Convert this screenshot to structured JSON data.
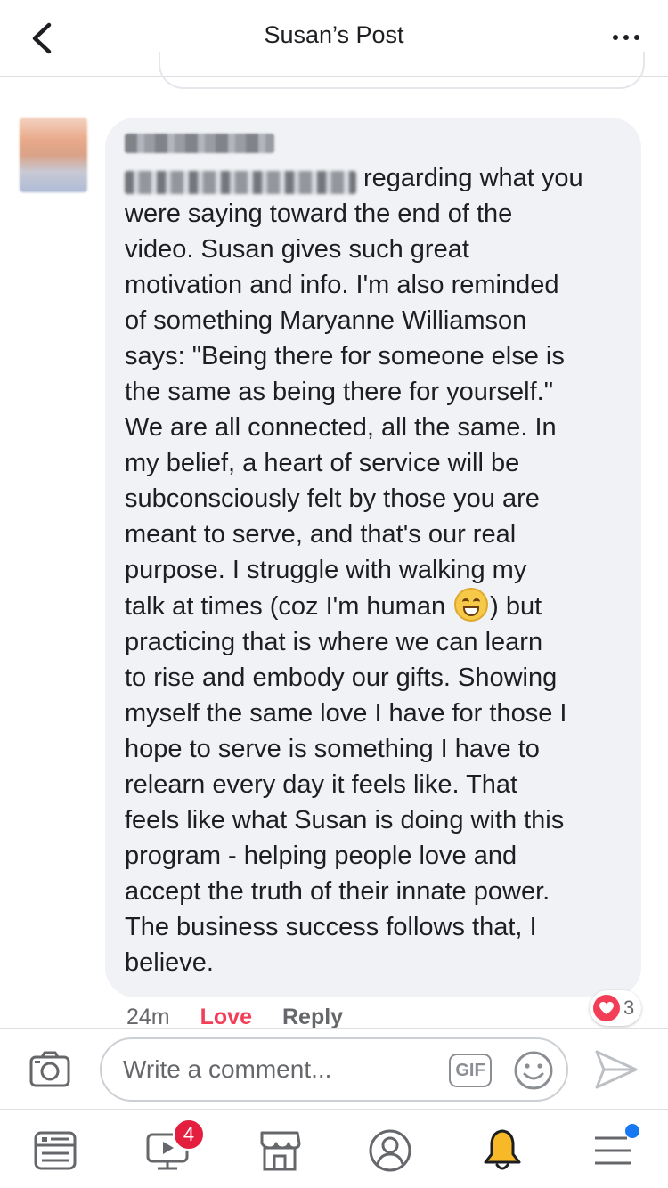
{
  "header": {
    "title": "Susan’s Post"
  },
  "comment": {
    "body": "regarding what you\nwere saying toward the end of the\nvideo. Susan gives such great\nmotivation and info. I'm also reminded\nof something Maryanne Williamson\nsays: \"Being there for someone else is\nthe same as being there for yourself.\"\nWe are all connected, all the same. In\nmy belief, a heart of service will be\nsubconsciously felt by those you are\nmeant to serve, and that's our real\npurpose. I struggle with walking my",
    "body_before_emoji": "talk at times (coz I'm human ",
    "emoji": "grinning-face-icon",
    "body_after_emoji": ") but\npracticing that is where we can learn\nto rise and embody our gifts. Showing\nmyself the same love I have for those I\nhope to serve is something I have to\nrelearn every day it feels like. That\nfeels like what Susan is doing with this\nprogram - helping people love and\naccept the truth of their innate power.\nThe business success follows that, I\nbelieve.",
    "time": "24m",
    "love_label": "Love",
    "reply_label": "Reply",
    "reaction_count": "3"
  },
  "composer": {
    "placeholder": "Write a comment...",
    "gif_label": "GIF"
  },
  "nav": {
    "video_badge": "4"
  },
  "colors": {
    "love": "#f33e58",
    "badge": "#e41e3f",
    "accent": "#1877f2",
    "bubble": "#f0f2f5"
  }
}
